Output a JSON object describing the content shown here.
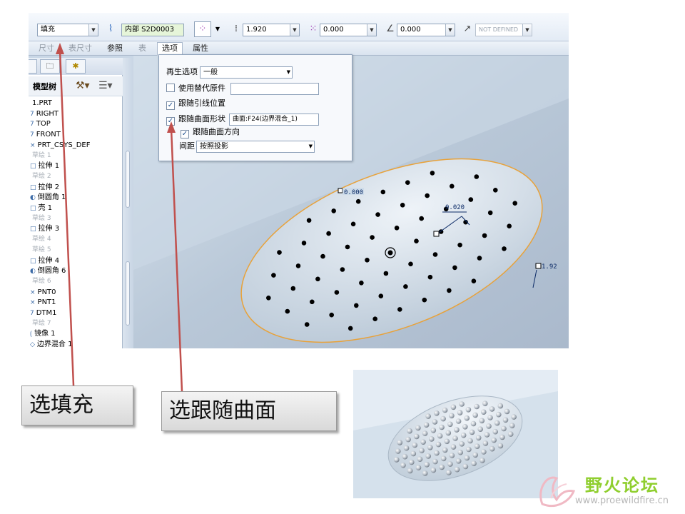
{
  "toolbar": {
    "fill_type": "填充",
    "placement": "内部 S2D0003",
    "spacing": "1.920",
    "offset": "0.000",
    "angle": "0.000",
    "not_defined": "NOT DEFINED"
  },
  "tabs": [
    {
      "label": "尺寸"
    },
    {
      "label": "表尺寸"
    },
    {
      "label": "参照"
    },
    {
      "label": "表"
    },
    {
      "label": "选项"
    },
    {
      "label": "属性"
    }
  ],
  "tree": {
    "title": "模型树",
    "items": [
      {
        "label": "1.PRT",
        "glyph": ""
      },
      {
        "label": "RIGHT",
        "glyph": "7"
      },
      {
        "label": "TOP",
        "glyph": "7"
      },
      {
        "label": "FRONT",
        "glyph": "7"
      },
      {
        "label": "PRT_CSYS_DEF",
        "glyph": "×"
      },
      {
        "label": "草绘 1",
        "glyph": "",
        "dim": true
      },
      {
        "label": "拉伸 1",
        "glyph": "□"
      },
      {
        "label": "草绘 2",
        "glyph": "",
        "dim": true
      },
      {
        "label": "拉伸 2",
        "glyph": "□"
      },
      {
        "label": "倒圆角 1",
        "glyph": "◐"
      },
      {
        "label": "壳 1",
        "glyph": "□"
      },
      {
        "label": "草绘 3",
        "glyph": "",
        "dim": true
      },
      {
        "label": "拉伸 3",
        "glyph": "□"
      },
      {
        "label": "草绘 4",
        "glyph": "",
        "dim": true
      },
      {
        "label": "草绘 5",
        "glyph": "",
        "dim": true
      },
      {
        "label": "拉伸 4",
        "glyph": "□"
      },
      {
        "label": "倒圆角 6",
        "glyph": "◐"
      },
      {
        "label": "草绘 6",
        "glyph": "",
        "dim": true
      },
      {
        "label": "PNT0",
        "glyph": "×"
      },
      {
        "label": "PNT1",
        "glyph": "×"
      },
      {
        "label": "DTM1",
        "glyph": "7"
      },
      {
        "label": "草绘 7",
        "glyph": "",
        "dim": true
      },
      {
        "label": "镜像 1",
        "glyph": "⟮"
      },
      {
        "label": "边界混合 1",
        "glyph": "◇"
      }
    ]
  },
  "options": {
    "regen_label": "再生选项",
    "regen_value": "一般",
    "alt_origin": "使用替代原件",
    "follow_leader": "跟随引线位置",
    "follow_surface": "跟随曲面形状",
    "surface_value": "曲面:F24(边界混合_1)",
    "follow_dir": "跟随曲面方向",
    "spacing_label": "间距",
    "spacing_value": "按照投影"
  },
  "dims": {
    "d1": "0.000",
    "d2": "0.020",
    "d3": "1.92"
  },
  "callouts": {
    "fill": "选填充",
    "follow": "选跟随曲面"
  },
  "watermark": {
    "name": "野火论坛",
    "url": "www.proewildfire.cn"
  },
  "colors": {
    "ellipse_outline": "#e8a23a",
    "arrow": "#c0504d",
    "tab_active": "#ffffff"
  }
}
